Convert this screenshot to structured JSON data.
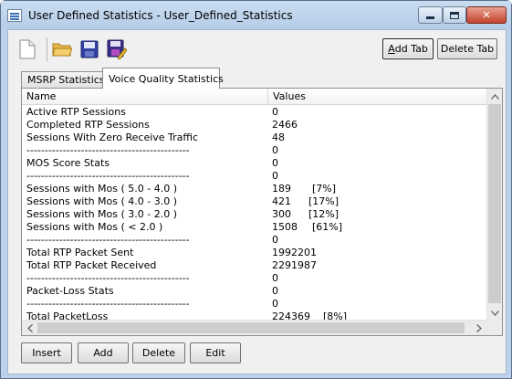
{
  "window": {
    "title": "User Defined Statistics - User_Defined_Statistics"
  },
  "toolbar": {
    "icons": [
      "new-file-icon",
      "open-folder-icon",
      "save-icon",
      "save-as-icon"
    ],
    "add_tab": "Add Tab",
    "add_tab_mnemonic": "A",
    "add_tab_rest": "dd Tab",
    "delete_tab": "Delete Tab"
  },
  "tabs": [
    {
      "label": "MSRP Statistics",
      "active": false
    },
    {
      "label": "Voice Quality Statistics",
      "active": true
    }
  ],
  "table": {
    "columns": [
      "Name",
      "Values"
    ],
    "rows": [
      {
        "name": "Active RTP Sessions",
        "value": "0",
        "pct": ""
      },
      {
        "name": "Completed RTP Sessions",
        "value": "2466",
        "pct": ""
      },
      {
        "name": "Sessions With Zero Receive Traffic",
        "value": "48",
        "pct": ""
      },
      {
        "name": "---------------------------------------------",
        "value": "0",
        "pct": ""
      },
      {
        "name": "MOS Score Stats",
        "value": "0",
        "pct": ""
      },
      {
        "name": "---------------------------------------------",
        "value": "0",
        "pct": ""
      },
      {
        "name": "Sessions with Mos ( 5.0 - 4.0 )",
        "value": "189",
        "pct": "[7%]"
      },
      {
        "name": "Sessions with Mos ( 4.0 - 3.0 )",
        "value": "421",
        "pct": "[17%]"
      },
      {
        "name": "Sessions with Mos ( 3.0 - 2.0 )",
        "value": "300",
        "pct": "[12%]"
      },
      {
        "name": "Sessions with Mos ( < 2.0 )",
        "value": "1508",
        "pct": "[61%]"
      },
      {
        "name": "---------------------------------------------",
        "value": "0",
        "pct": ""
      },
      {
        "name": "Total RTP Packet Sent",
        "value": "1992201",
        "pct": ""
      },
      {
        "name": "Total RTP Packet Received",
        "value": "2291987",
        "pct": ""
      },
      {
        "name": "---------------------------------------------",
        "value": "0",
        "pct": ""
      },
      {
        "name": "Packet-Loss Stats",
        "value": "0",
        "pct": ""
      },
      {
        "name": "---------------------------------------------",
        "value": "0",
        "pct": ""
      },
      {
        "name": "Total PacketLoss",
        "value": "224369",
        "pct": "[8%]"
      }
    ]
  },
  "scroll": {
    "left": "<",
    "right": ">",
    "up": "^",
    "down": "v"
  },
  "buttons": {
    "insert": "Insert",
    "add": "Add",
    "delete": "Delete",
    "edit": "Edit"
  }
}
